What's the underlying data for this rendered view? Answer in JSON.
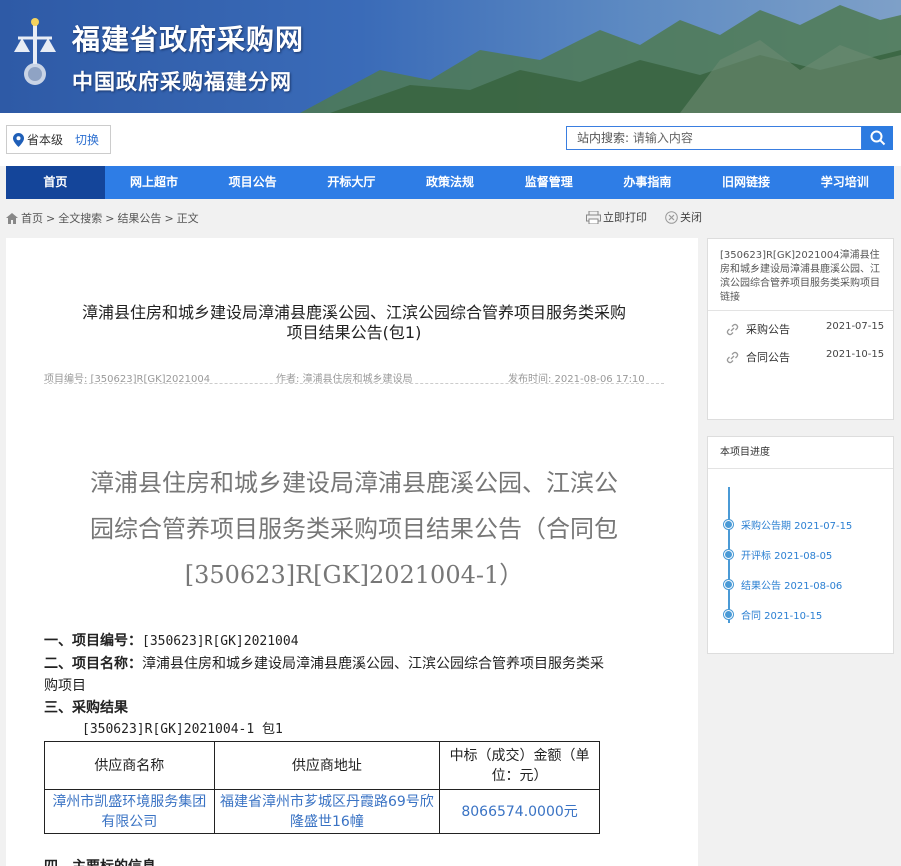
{
  "header": {
    "site_title": "福建省政府采购网",
    "site_subtitle": "中国政府采购福建分网"
  },
  "topbar": {
    "region": "省本级",
    "switch_label": "切换",
    "search_label": "站内搜索:",
    "search_placeholder": "请输入内容"
  },
  "nav": {
    "items": [
      "首页",
      "网上超市",
      "项目公告",
      "开标大厅",
      "政策法规",
      "监督管理",
      "办事指南",
      "旧网链接",
      "学习培训"
    ],
    "active_index": 0
  },
  "breadcrumb": {
    "items": [
      "首页",
      "全文搜索",
      "结果公告",
      "正文"
    ],
    "separator": ">"
  },
  "tools": {
    "print": "立即打印",
    "close": "关闭"
  },
  "article": {
    "title_line1": "漳浦县住房和城乡建设局漳浦县鹿溪公园、江滨公园综合管养项目服务类采购",
    "title_line2": "项目结果公告(包1)",
    "meta_code": "项目编号: [350623]R[GK]2021004",
    "meta_author": "作者: 漳浦县住房和城乡建设局",
    "meta_time": "发布时间: 2021-08-06 17:10",
    "big_line1": "漳浦县住房和城乡建设局漳浦县鹿溪公园、江滨公",
    "big_line2": "园综合管养项目服务类采购项目结果公告（合同包",
    "big_line3": "[350623]R[GK]2021004-1）",
    "s1_label": "一、项目编号：",
    "s1_value": "[350623]R[GK]2021004",
    "s2_label": "二、项目名称：",
    "s2_value_line1": "漳浦县住房和城乡建设局漳浦县鹿溪公园、江滨公园综合管养项目服务类采",
    "s2_value_line2": "购项目",
    "s3_label": "三、采购结果",
    "s3_package": "[350623]R[GK]2021004-1 包1",
    "table": {
      "headers": [
        "供应商名称",
        "供应商地址",
        "中标（成交）金额（单位：元）"
      ],
      "header_amount_line1": "中标（成交）金额（单",
      "header_amount_line2": "位：元）",
      "row": {
        "name_line1": "漳州市凯盛环境服务集团",
        "name_line2": "有限公司",
        "address_line1": "福建省漳州市芗城区丹霞路69号欣",
        "address_line2": "隆盛世16幢",
        "amount": "8066574.0000元"
      }
    },
    "s4_label": "四、主要标的信息"
  },
  "related": {
    "header": "[350623]R[GK]2021004漳浦县住房和城乡建设局漳浦县鹿溪公园、江滨公园综合管养项目服务类采购项目链接",
    "items": [
      {
        "label": "采购公告",
        "date": "2021-07-15"
      },
      {
        "label": "合同公告",
        "date": "2021-10-15"
      }
    ]
  },
  "progress": {
    "header": "本项目进度",
    "items": [
      "采购公告期 2021-07-15",
      "开评标 2021-08-05",
      "结果公告 2021-08-06",
      "合同 2021-10-15"
    ]
  },
  "colors": {
    "nav_bg": "#2e7de6",
    "nav_active": "#14459a",
    "link_blue": "#2c6fd0"
  }
}
